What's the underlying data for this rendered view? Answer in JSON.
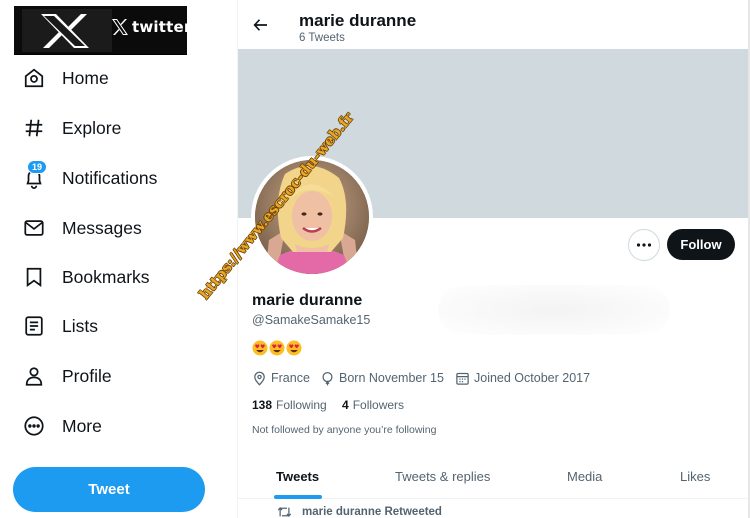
{
  "logo": {
    "brand_word": "twitter"
  },
  "sidebar": {
    "items": [
      {
        "label": "Home",
        "icon": "home-icon"
      },
      {
        "label": "Explore",
        "icon": "hashtag-icon"
      },
      {
        "label": "Notifications",
        "icon": "bell-icon",
        "badge": "19"
      },
      {
        "label": "Messages",
        "icon": "envelope-icon"
      },
      {
        "label": "Bookmarks",
        "icon": "bookmark-icon"
      },
      {
        "label": "Lists",
        "icon": "list-icon"
      },
      {
        "label": "Profile",
        "icon": "person-icon"
      },
      {
        "label": "More",
        "icon": "more-circle-icon"
      }
    ],
    "tweet_button": "Tweet"
  },
  "header": {
    "name": "marie duranne",
    "tweet_count": "6 Tweets"
  },
  "profile": {
    "name": "marie duranne",
    "handle": "@SamakeSamake15",
    "bio_emoji": [
      "heart-eyes-emoji",
      "heart-eyes-emoji",
      "heart-eyes-emoji"
    ],
    "location": "France",
    "born": "Born November 15",
    "joined": "Joined October 2017",
    "following_count": "138",
    "following_label": "Following",
    "followers_count": "4",
    "followers_label": "Followers",
    "not_followed": "Not followed by anyone you’re following",
    "follow_button": "Follow"
  },
  "tabs": [
    {
      "label": "Tweets",
      "active": true
    },
    {
      "label": "Tweets & replies",
      "active": false
    },
    {
      "label": "Media",
      "active": false
    },
    {
      "label": "Likes",
      "active": false
    }
  ],
  "timeline": {
    "retweet_note": "marie duranne Retweeted"
  },
  "watermark": {
    "text": "https://www.escroc-du-web.fr"
  },
  "colors": {
    "accent": "#1d9bf0",
    "text": "#0f1419",
    "muted": "#536471",
    "banner": "#cfd9de"
  }
}
